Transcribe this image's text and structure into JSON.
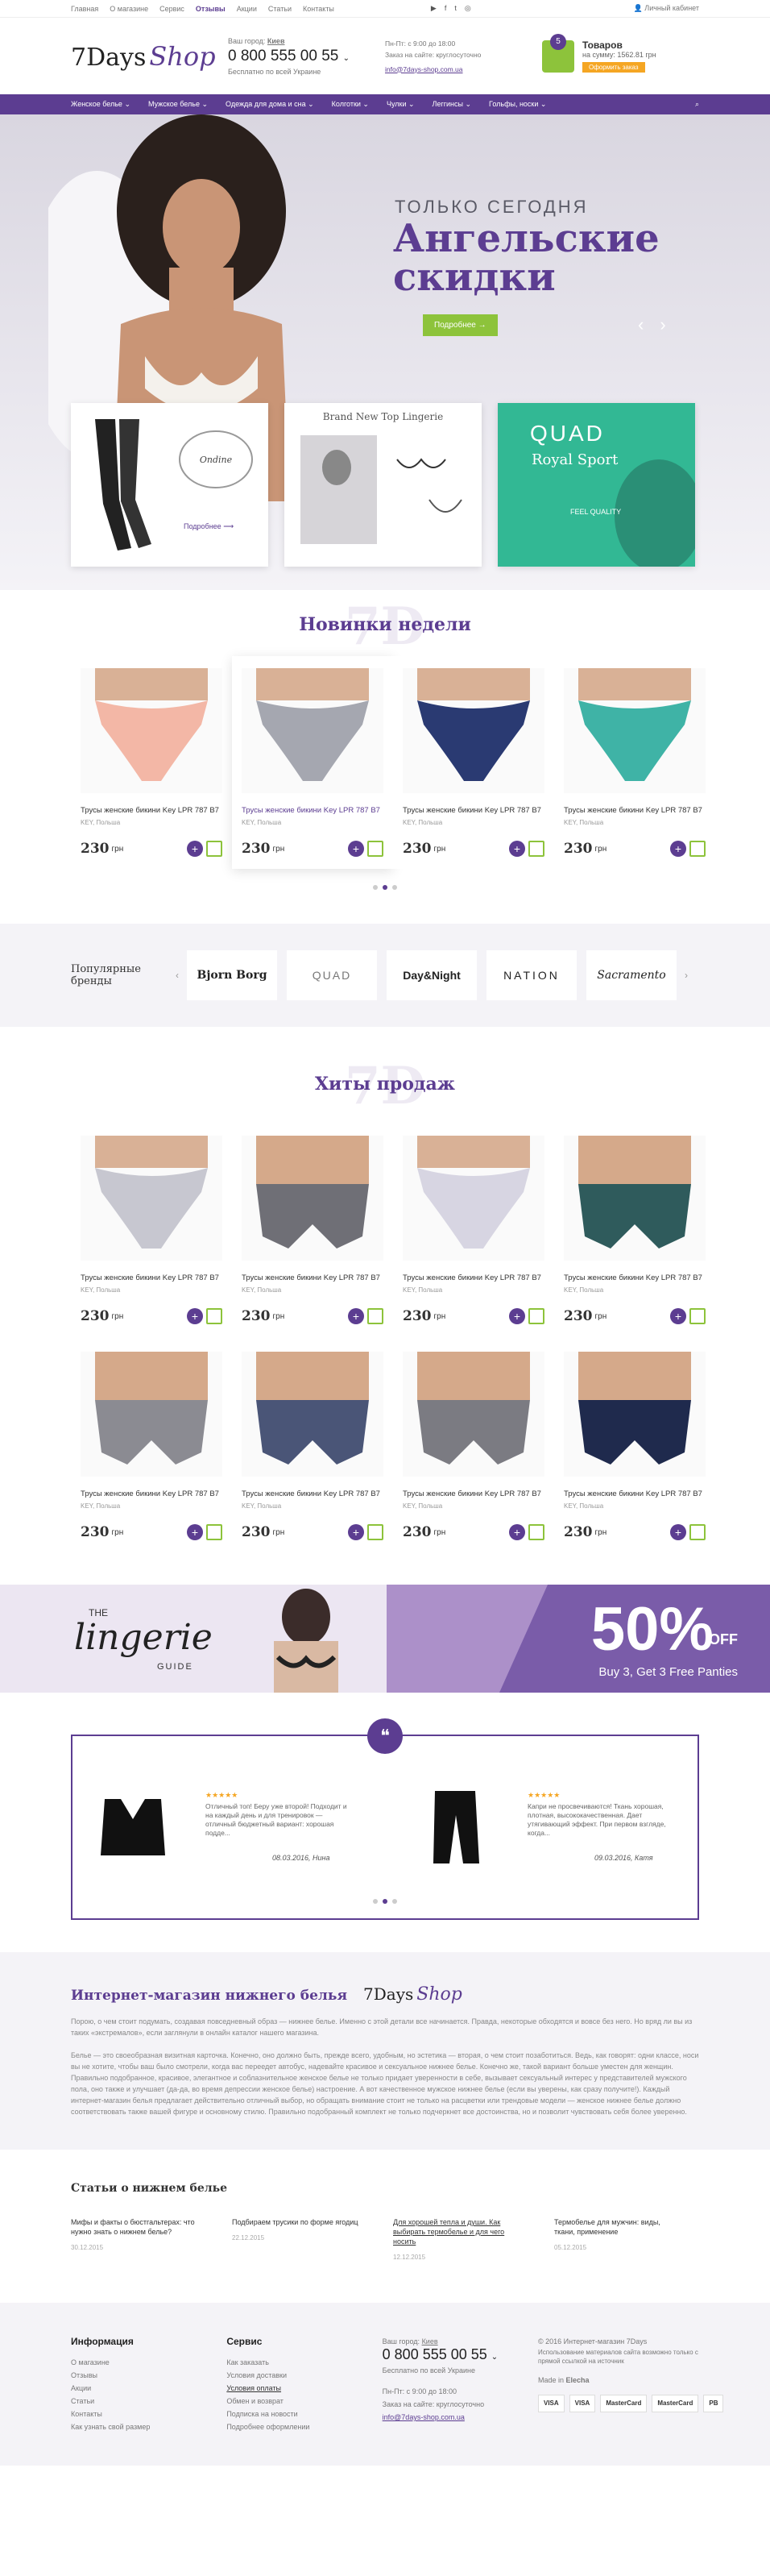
{
  "topbar": {
    "links": [
      "Главная",
      "О магазине",
      "Сервис",
      "Отзывы",
      "Акции",
      "Статьи",
      "Контакты"
    ],
    "active_index": 3,
    "account": "Личный кабинет"
  },
  "header": {
    "logo_main": "7Days",
    "logo_script": "Shop",
    "city_label": "Ваш город",
    "city": "Киев",
    "phone": "0 800 555 00 55",
    "phone_note": "Бесплатно по всей Украине",
    "hours_line1": "Пн-Пт: с 9:00 до 18:00",
    "hours_line2": "Заказ на сайте: круглосуточно",
    "email": "info@7days-shop.com.ua",
    "cart_count": "5",
    "cart_title": "Товаров",
    "cart_sum": "на сумму: 1562.81 грн",
    "cart_button": "Оформить заказ"
  },
  "nav": {
    "items": [
      "Женское белье",
      "Мужское белье",
      "Одежда для дома и сна",
      "Колготки",
      "Чулки",
      "Леггинсы",
      "Гольфы, носки"
    ],
    "search_icon": "search-icon"
  },
  "hero": {
    "kicker": "ТОЛЬКО СЕГОДНЯ",
    "title_line1": "Ангельские",
    "title_line2": "скидки",
    "cta": "Подробнее",
    "promo1_label": "Подробнее",
    "promo2_title": "Brand New Top Lingerie",
    "promo3_brand": "QUAD",
    "promo3_sub": "Royal Sport",
    "promo3_feel": "FEEL QUALITY"
  },
  "new_week": {
    "ghost": "7D",
    "title": "Новинки недели",
    "products": [
      {
        "name": "Трусы женские бикини Key LPR 787 B7",
        "brand": "KEY, Польша",
        "price": "230",
        "currency": "грн",
        "color": "#f3b7a6"
      },
      {
        "name": "Трусы женские бикини Key LPR 787 B7",
        "brand": "KEY, Польша",
        "price": "230",
        "currency": "грн",
        "color": "#a5a7b0"
      },
      {
        "name": "Трусы женские бикини Key LPR 787 B7",
        "brand": "KEY, Польша",
        "price": "230",
        "currency": "грн",
        "color": "#2a3a72"
      },
      {
        "name": "Трусы женские бикини Key LPR 787 B7",
        "brand": "KEY, Польша",
        "price": "230",
        "currency": "грн",
        "color": "#3fb3a6"
      }
    ]
  },
  "brands": {
    "title_line1": "Популярные",
    "title_line2": "бренды",
    "items": [
      "Bjorn Borg",
      "QUAD",
      "Day&Night",
      "NATION",
      "Sacramento"
    ]
  },
  "hits": {
    "ghost": "7D",
    "title": "Хиты продаж",
    "products": [
      {
        "name": "Трусы женские бикини Key LPR 787 B7",
        "brand": "KEY, Польша",
        "price": "230",
        "currency": "грн",
        "color": "#c7c7d0"
      },
      {
        "name": "Трусы женские бикини Key LPR 787 B7",
        "brand": "KEY, Польша",
        "price": "230",
        "currency": "грн",
        "color": "#6f6f76"
      },
      {
        "name": "Трусы женские бикини Key LPR 787 B7",
        "brand": "KEY, Польша",
        "price": "230",
        "currency": "грн",
        "color": "#d7d5e2"
      },
      {
        "name": "Трусы женские бикини Key LPR 787 B7",
        "brand": "KEY, Польша",
        "price": "230",
        "currency": "грн",
        "color": "#2f5b5c"
      },
      {
        "name": "Трусы женские бикини Key LPR 787 B7",
        "brand": "KEY, Польша",
        "price": "230",
        "currency": "грн",
        "color": "#8b8b92"
      },
      {
        "name": "Трусы женские бикини Key LPR 787 B7",
        "brand": "KEY, Польша",
        "price": "230",
        "currency": "грн",
        "color": "#4a5577"
      },
      {
        "name": "Трусы женские бикини Key LPR 787 B7",
        "brand": "KEY, Польша",
        "price": "230",
        "currency": "грн",
        "color": "#7b7b82"
      },
      {
        "name": "Трусы женские бикини Key LPR 787 B7",
        "brand": "KEY, Польша",
        "price": "230",
        "currency": "грн",
        "color": "#1f2a4d"
      }
    ]
  },
  "banners": {
    "the": "THE",
    "lingerie": "lingerie",
    "guide": "GUIDE",
    "percent": "50%",
    "off": "OFF",
    "buy": "Buy 3, Get 3 Free Panties"
  },
  "reviews": {
    "items": [
      {
        "stars": "★★★★★",
        "text": "Отличный топ! Беру уже второй! Подходит и на каждый день и для тренировок — отличный бюджетный вариант: хорошая подде...",
        "date": "08.03.2016, Нина"
      },
      {
        "stars": "★★★★★",
        "text": "Капри не просвечиваются! Ткань хорошая, плотная, высококачественная. Дает утягивающий эффект. При первом взгляде, когда...",
        "date": "09.03.2016, Катя"
      }
    ]
  },
  "about": {
    "title": "Интернет-магазин нижнего белья",
    "logo_main": "7Days",
    "logo_script": "Shop",
    "p1": "Порою, о чем стоит подумать, создавая повседневный образ — нижнее белье. Именно с этой детали все начинается. Правда, некоторые обходятся и вовсе без него. Но вряд ли вы из таких «экстремалов», если заглянули в онлайн каталог нашего магазина.",
    "p2": "Белье — это своеобразная визитная карточка. Конечно, оно должно быть, прежде всего, удобным, но эстетика — вторая, о чем стоит позаботиться. Ведь, как говорят: одни классе, носи вы не хотите, чтобы ваш было смотрели, когда вас переедет автобус, надевайте красивое и сексуальное нижнее белье. Конечно же, такой вариант больше уместен для женщин. Правильно подобранное, красивое, элегантное и соблазнительное женское белье не только придает уверенности в себе, вызывает сексуальный интерес у представителей мужского пола, оно также и улучшает (да-да, во время депрессии женское белье) настроение. А вот качественное мужское нижнее белье (если вы уверены, как сразу получите!). Каждый интернет-магазин белья предлагает действительно отличный выбор, но обращать внимание стоит не только на расцветки или трендовые модели — женское нижнее белье должно соответствовать также вашей фигуре и основному стилю. Правильно подобранный комплект не только подчеркнет все достоинства, но и позволит чувствовать себя более уверенно."
  },
  "articles": {
    "title": "Статьи о нижнем белье",
    "items": [
      {
        "t": "Мифы и факты о бюстгальтерах: что нужно знать о нижнем белье?",
        "d": "30.12.2015"
      },
      {
        "t": "Подбираем трусики по форме ягодиц",
        "d": "22.12.2015"
      },
      {
        "t": "Для хорошей тепла и души. Как выбирать термобелье и для чего носить",
        "d": "12.12.2015"
      },
      {
        "t": "Термобелье для мужчин: виды, ткани, применение",
        "d": "05.12.2015"
      }
    ]
  },
  "footer": {
    "info_title": "Информация",
    "info": [
      "О магазине",
      "Отзывы",
      "Акции",
      "Статьи",
      "Контакты",
      "Как узнать свой размер"
    ],
    "service_title": "Сервис",
    "service": [
      "Как заказать",
      "Условия доставки",
      "Условия оплаты",
      "Обмен и возврат",
      "Подписка на новости",
      "Подробнее оформлении"
    ],
    "city_label": "Ваш город",
    "city": "Киев",
    "phone": "0 800 555 00 55",
    "phone_note": "Бесплатно по всей Украине",
    "hours_line1": "Пн-Пт: с 9:00 до 18:00",
    "hours_line2": "Заказ на сайте: круглосуточно",
    "email": "info@7days-shop.com.ua",
    "copyright": "© 2016 Интернет-магазин 7Days",
    "note": "Использование материалов сайта возможно только с прямой ссылкой на источник",
    "made": "Made in",
    "maker": "Elecha",
    "payments": [
      "VISA",
      "VISA",
      "MasterCard",
      "MasterCard",
      "PB"
    ]
  }
}
